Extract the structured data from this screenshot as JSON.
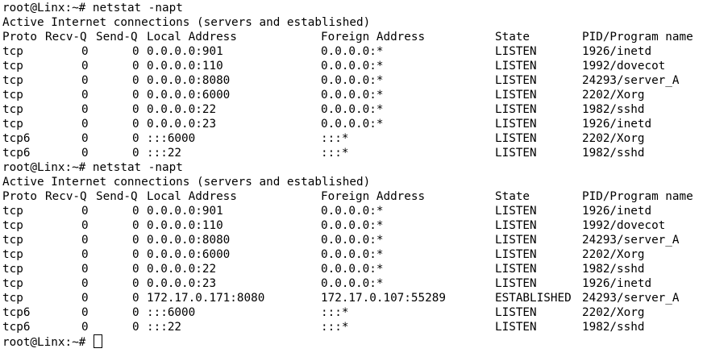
{
  "terminal": {
    "prompt": "root@Linx:~# ",
    "blocks": [
      {
        "command": "netstat -napt",
        "title": "Active Internet connections (servers and established)",
        "headers": {
          "proto": "Proto",
          "recvq": "Recv-Q",
          "sendq": "Send-Q",
          "local": "Local Address",
          "foreign": "Foreign Address",
          "state": "State",
          "pid": "PID/Program name"
        },
        "rows": [
          {
            "proto": "tcp",
            "recvq": "0",
            "sendq": "0",
            "local": "0.0.0.0:901",
            "foreign": "0.0.0.0:*",
            "state": "LISTEN",
            "pid": "1926/inetd"
          },
          {
            "proto": "tcp",
            "recvq": "0",
            "sendq": "0",
            "local": "0.0.0.0:110",
            "foreign": "0.0.0.0:*",
            "state": "LISTEN",
            "pid": "1992/dovecot"
          },
          {
            "proto": "tcp",
            "recvq": "0",
            "sendq": "0",
            "local": "0.0.0.0:8080",
            "foreign": "0.0.0.0:*",
            "state": "LISTEN",
            "pid": "24293/server_A"
          },
          {
            "proto": "tcp",
            "recvq": "0",
            "sendq": "0",
            "local": "0.0.0.0:6000",
            "foreign": "0.0.0.0:*",
            "state": "LISTEN",
            "pid": "2202/Xorg"
          },
          {
            "proto": "tcp",
            "recvq": "0",
            "sendq": "0",
            "local": "0.0.0.0:22",
            "foreign": "0.0.0.0:*",
            "state": "LISTEN",
            "pid": "1982/sshd"
          },
          {
            "proto": "tcp",
            "recvq": "0",
            "sendq": "0",
            "local": "0.0.0.0:23",
            "foreign": "0.0.0.0:*",
            "state": "LISTEN",
            "pid": "1926/inetd"
          },
          {
            "proto": "tcp6",
            "recvq": "0",
            "sendq": "0",
            "local": ":::6000",
            "foreign": ":::*",
            "state": "LISTEN",
            "pid": "2202/Xorg"
          },
          {
            "proto": "tcp6",
            "recvq": "0",
            "sendq": "0",
            "local": ":::22",
            "foreign": ":::*",
            "state": "LISTEN",
            "pid": "1982/sshd"
          }
        ]
      },
      {
        "command": "netstat -napt",
        "title": "Active Internet connections (servers and established)",
        "headers": {
          "proto": "Proto",
          "recvq": "Recv-Q",
          "sendq": "Send-Q",
          "local": "Local Address",
          "foreign": "Foreign Address",
          "state": "State",
          "pid": "PID/Program name"
        },
        "rows": [
          {
            "proto": "tcp",
            "recvq": "0",
            "sendq": "0",
            "local": "0.0.0.0:901",
            "foreign": "0.0.0.0:*",
            "state": "LISTEN",
            "pid": "1926/inetd"
          },
          {
            "proto": "tcp",
            "recvq": "0",
            "sendq": "0",
            "local": "0.0.0.0:110",
            "foreign": "0.0.0.0:*",
            "state": "LISTEN",
            "pid": "1992/dovecot"
          },
          {
            "proto": "tcp",
            "recvq": "0",
            "sendq": "0",
            "local": "0.0.0.0:8080",
            "foreign": "0.0.0.0:*",
            "state": "LISTEN",
            "pid": "24293/server_A"
          },
          {
            "proto": "tcp",
            "recvq": "0",
            "sendq": "0",
            "local": "0.0.0.0:6000",
            "foreign": "0.0.0.0:*",
            "state": "LISTEN",
            "pid": "2202/Xorg"
          },
          {
            "proto": "tcp",
            "recvq": "0",
            "sendq": "0",
            "local": "0.0.0.0:22",
            "foreign": "0.0.0.0:*",
            "state": "LISTEN",
            "pid": "1982/sshd"
          },
          {
            "proto": "tcp",
            "recvq": "0",
            "sendq": "0",
            "local": "0.0.0.0:23",
            "foreign": "0.0.0.0:*",
            "state": "LISTEN",
            "pid": "1926/inetd"
          },
          {
            "proto": "tcp",
            "recvq": "0",
            "sendq": "0",
            "local": "172.17.0.171:8080",
            "foreign": "172.17.0.107:55289",
            "state": "ESTABLISHED",
            "pid": "24293/server_A"
          },
          {
            "proto": "tcp6",
            "recvq": "0",
            "sendq": "0",
            "local": ":::6000",
            "foreign": ":::*",
            "state": "LISTEN",
            "pid": "2202/Xorg"
          },
          {
            "proto": "tcp6",
            "recvq": "0",
            "sendq": "0",
            "local": ":::22",
            "foreign": ":::*",
            "state": "LISTEN",
            "pid": "1982/sshd"
          }
        ]
      }
    ]
  }
}
